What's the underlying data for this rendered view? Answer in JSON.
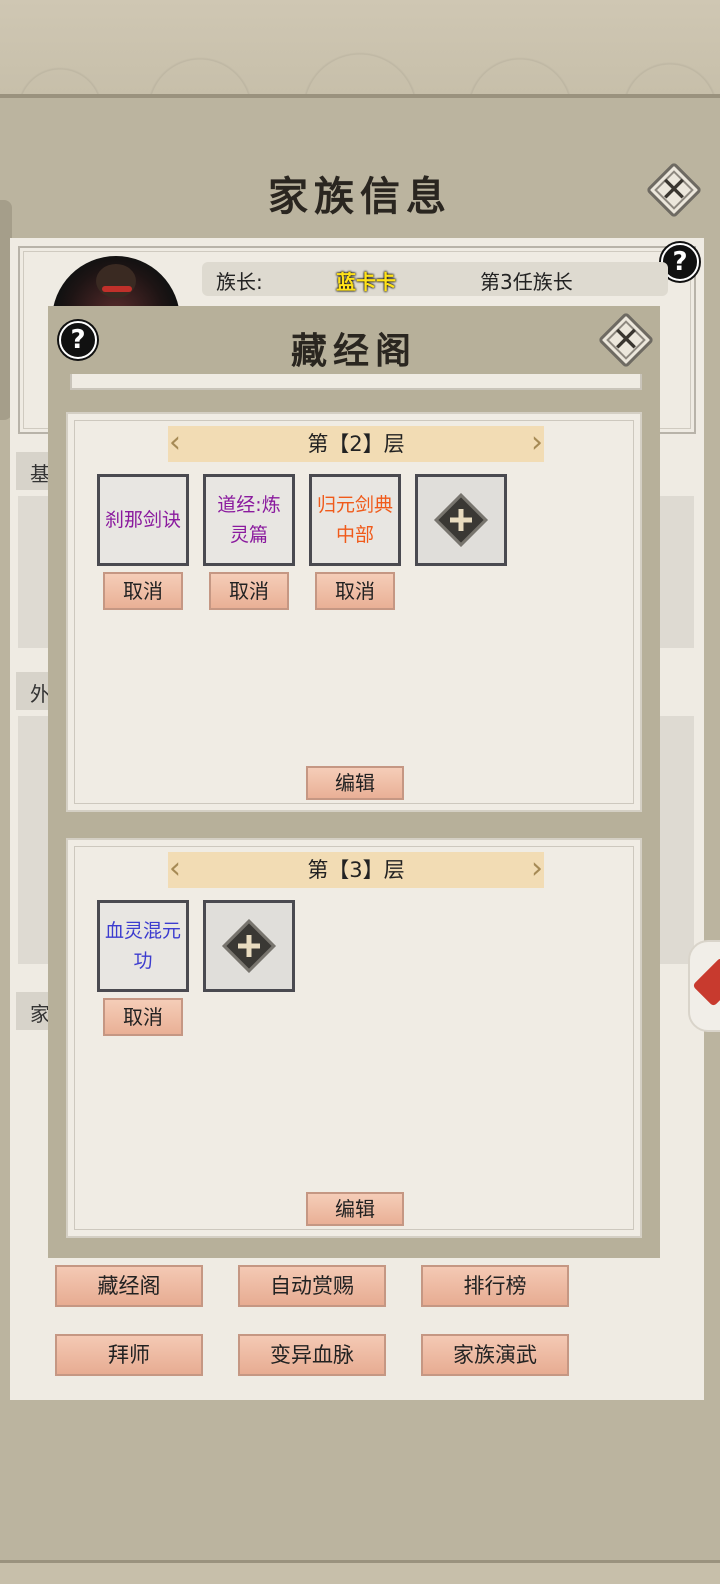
{
  "family": {
    "title": "家族信息",
    "leader_label": "族长:",
    "leader_name": "蓝卡卡",
    "leader_generation": "第3任族长",
    "section_tabs": [
      "基",
      "外",
      "家"
    ],
    "buttons": [
      {
        "label": "藏经阁"
      },
      {
        "label": "自动赏赐"
      },
      {
        "label": "排行榜"
      },
      {
        "label": "拜师"
      },
      {
        "label": "变异血脉"
      },
      {
        "label": "家族演武"
      }
    ]
  },
  "modal": {
    "title": "藏经阁",
    "help_icon": "?",
    "close_icon": "✕",
    "floors": [
      {
        "header": "第【2】层",
        "books": [
          {
            "title": "刹那剑诀",
            "color": "#8a1a9e"
          },
          {
            "title": "道经:炼灵篇",
            "color": "#8a1a9e"
          },
          {
            "title": "归元剑典中部",
            "color": "#f05a1a"
          }
        ],
        "cancel_label": "取消",
        "edit_label": "编辑"
      },
      {
        "header": "第【3】层",
        "books": [
          {
            "title": "血灵混元功",
            "color": "#3c3ccf"
          }
        ],
        "cancel_label": "取消",
        "edit_label": "编辑"
      }
    ]
  },
  "colors": {
    "accent_button": "#e9b096",
    "leader_name": "#ffe21a",
    "panel_bg": "#efebe3",
    "modal_bg": "#b7b09a"
  }
}
